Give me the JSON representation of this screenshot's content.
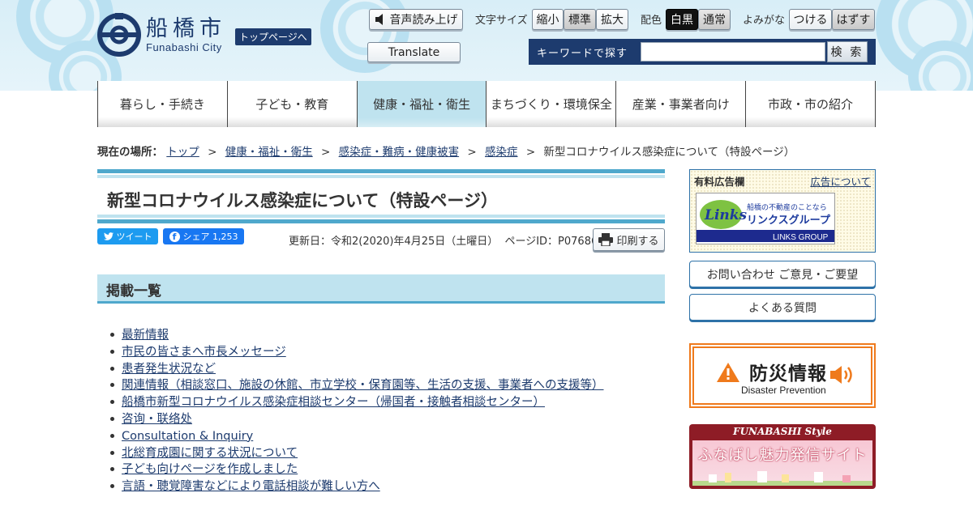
{
  "header": {
    "logo_jp": "船橋市",
    "logo_en": "Funabashi City",
    "top_link": "トップページへ",
    "tools": {
      "voice": "音声読み上げ",
      "translate": "Translate",
      "font_size_label": "文字サイズ",
      "font_small": "縮小",
      "font_standard": "標準",
      "font_large": "拡大",
      "color_label": "配色",
      "color_bw": "白黒",
      "color_normal": "通常",
      "furigana_label": "よみがな",
      "furigana_on": "つける",
      "furigana_off": "はずす"
    },
    "search": {
      "label": "キーワードで探す",
      "button": "検 索",
      "value": ""
    }
  },
  "nav": {
    "items": [
      {
        "label": "暮らし・手続き"
      },
      {
        "label": "子ども・教育"
      },
      {
        "label": "健康・福祉・衛生"
      },
      {
        "label": "まちづくり・環境保全"
      },
      {
        "label": "産業・事業者向け"
      },
      {
        "label": "市政・市の紹介"
      }
    ],
    "active_index": 2
  },
  "breadcrumb": {
    "label": "現在の場所：",
    "items": [
      "トップ",
      "健康・福祉・衛生",
      "感染症・難病・健康被害",
      "感染症"
    ],
    "current": "新型コロナウイルス感染症について（特設ページ）",
    "sep": ">"
  },
  "main": {
    "title": "新型コロナウイルス感染症について（特設ページ）",
    "tweet": "ツイート",
    "share": "シェア 1,253",
    "updated": "更新日：令和2(2020)年4月25日（土曜日）",
    "page_id": "ページID：P076863",
    "print": "印刷する",
    "section_title": "掲載一覧",
    "links": [
      "最新情報",
      "市民の皆さまへ市長メッセージ",
      "患者発生状況など",
      "関連情報（相談窓口、施設の休館、市立学校・保育園等、生活の支援、事業者への支援等）",
      "船橋市新型コロナウイルス感染症相談センター（帰国者・接触者相談センター）",
      "咨询・联络处",
      "Consultation & Inquiry",
      "北総育成園に関する状況について",
      "子ども向けページを作成しました",
      "言語・聴覚障害などにより電話相談が難しい方へ"
    ]
  },
  "sidebar": {
    "ad_title": "有料広告欄",
    "ad_about": "広告について",
    "ad_banner": {
      "sub": "船橋の不動産のことなら",
      "main": "リンクスグループ",
      "brand": "Links",
      "footer": "LINKS GROUP"
    },
    "contact": "お問い合わせ ご意見・ご要望",
    "faq": "よくある質問",
    "disaster_jp": "防災情報",
    "disaster_en": "Disaster Prevention",
    "style_top": "FUNABASHI Style",
    "style_jp": "ふなばし魅力発信サイト"
  },
  "colors": {
    "navy": "#1d3b6e",
    "accent_blue": "#4fa8cc",
    "light_blue": "#bfe3ef",
    "disaster_orange": "#ef7a1c",
    "style_red": "#8e1c26"
  }
}
